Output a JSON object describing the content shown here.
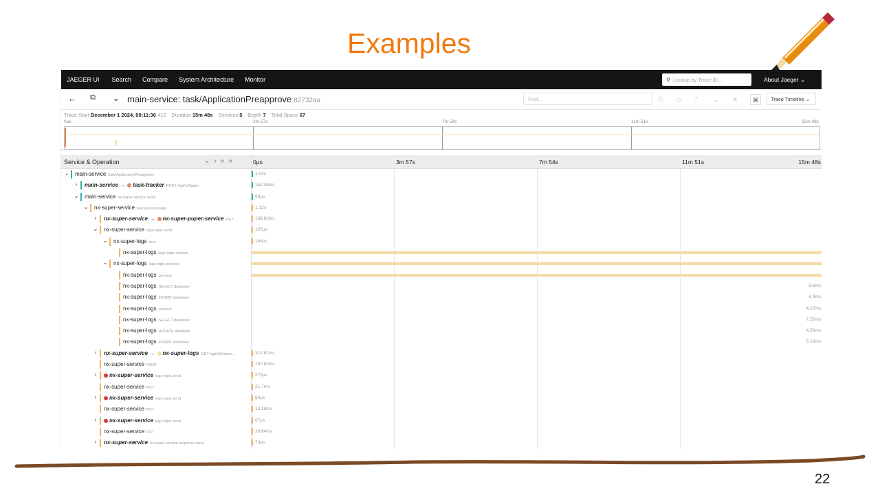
{
  "slide": {
    "title": "Examples",
    "page_number": "22"
  },
  "nav": {
    "brand": "JAEGER UI",
    "items": [
      "Search",
      "Compare",
      "System Architecture",
      "Monitor"
    ],
    "lookup_placeholder": "Lookup by Trace ID...",
    "about": "About Jaeger"
  },
  "trace": {
    "service": "main-service",
    "name": "main-service: task/ApplicationPreapprove",
    "id": "82732aa",
    "find_placeholder": "Find...",
    "timeline_button": "Trace Timeline"
  },
  "meta": {
    "start_label": "Trace Start",
    "start_value": "December 1 2024, 00:11:36",
    "start_ms": ".412",
    "duration_label": "Duration",
    "duration_value": "15m 48s",
    "services_label": "Services",
    "services_value": "5",
    "depth_label": "Depth",
    "depth_value": "7",
    "spans_label": "Total Spans",
    "spans_value": "67"
  },
  "ticks": [
    "0μs",
    "3m 57s",
    "7m 54s",
    "11m 51s",
    "15m 48s"
  ],
  "header": {
    "service_operation": "Service & Operation"
  },
  "colors": {
    "main": "#2bb5a8",
    "super": "#f2b25e",
    "tracker": "#e08a5c",
    "error": "#d9363e",
    "bar": "#f3dca7"
  },
  "rows": [
    {
      "depth": 0,
      "toggle": "v",
      "svc": "main-service",
      "op": "task/ApplicationPreapprove",
      "bold": false,
      "color": "main",
      "dur": "1.04s"
    },
    {
      "depth": 1,
      "toggle": ">",
      "svc": "main-service",
      "bold": true,
      "arrow": true,
      "dot": "tracker",
      "svc2": "task-tracker",
      "op": "POST /api/v1/tasks",
      "color": "main",
      "dur": "152.36ms"
    },
    {
      "depth": 1,
      "toggle": "v",
      "svc": "main-service",
      "op": "nx-super-service send",
      "bold": false,
      "color": "main",
      "dur": "69μs"
    },
    {
      "depth": 2,
      "toggle": "v",
      "svc": "nx-super-service",
      "op": "process message",
      "bold": false,
      "color": "super",
      "dur": "1.12s"
    },
    {
      "depth": 3,
      "toggle": ">",
      "svc": "nx-super-service",
      "bold": true,
      "arrow": true,
      "dot": "tracker",
      "svc2": "nx-super-puper-service",
      "op": "GET ...",
      "color": "super",
      "dur": "138.82ms"
    },
    {
      "depth": 3,
      "toggle": "v",
      "svc": "nx-super-service",
      "op": "logs-topic send",
      "bold": false,
      "color": "super",
      "dur": "107μs"
    },
    {
      "depth": 4,
      "toggle": "v",
      "svc": "nx-super-logs",
      "op": "recv",
      "bold": false,
      "color": "super",
      "dur": "146μs"
    },
    {
      "depth": 5,
      "toggle": "",
      "svc": "nx-super-logs",
      "op": "logs-topic receive",
      "bold": false,
      "color": "super",
      "bar": true
    },
    {
      "depth": 4,
      "toggle": "v",
      "svc": "nx-super-logs",
      "op": "logs-topic process",
      "bold": false,
      "color": "super",
      "bar": true
    },
    {
      "depth": 5,
      "toggle": "",
      "svc": "nx-super-logs",
      "op": "connect",
      "bold": false,
      "color": "super",
      "bar": true
    },
    {
      "depth": 5,
      "toggle": "",
      "svc": "nx-super-logs",
      "op": "SELECT database",
      "bold": false,
      "color": "super",
      "right": "8.6ms"
    },
    {
      "depth": 5,
      "toggle": "",
      "svc": "nx-super-logs",
      "op": "INSERT database",
      "bold": false,
      "color": "super",
      "right": "4.3ms"
    },
    {
      "depth": 5,
      "toggle": "",
      "svc": "nx-super-logs",
      "op": "connect",
      "bold": false,
      "color": "super",
      "right": "4.17ms"
    },
    {
      "depth": 5,
      "toggle": "",
      "svc": "nx-super-logs",
      "op": "SELECT database",
      "bold": false,
      "color": "super",
      "right": "7.55ms"
    },
    {
      "depth": 5,
      "toggle": "",
      "svc": "nx-super-logs",
      "op": "UPDATE database",
      "bold": false,
      "color": "super",
      "right": "4.56ms"
    },
    {
      "depth": 5,
      "toggle": "",
      "svc": "nx-super-logs",
      "op": "INSERT database",
      "bold": false,
      "color": "super",
      "right": "5.16ms"
    },
    {
      "depth": 3,
      "toggle": ">",
      "svc": "nx-super-service",
      "bold": true,
      "arrow": true,
      "dot": "bar",
      "svc2": "nx-super-logs",
      "op": "GET /api/v1/intern...",
      "color": "super",
      "dur": "312.81ms"
    },
    {
      "depth": 3,
      "toggle": "",
      "svc": "nx-super-service",
      "op": "POST",
      "bold": false,
      "color": "super",
      "dur": "797.82ms"
    },
    {
      "depth": 3,
      "toggle": ">",
      "svc": "nx-super-service",
      "bold": true,
      "errdot": true,
      "op": "logs-topic send",
      "color": "super",
      "dur": "270μs"
    },
    {
      "depth": 3,
      "toggle": "",
      "svc": "nx-super-service",
      "op": "PUT",
      "bold": false,
      "color": "super",
      "dur": "21.7ms"
    },
    {
      "depth": 3,
      "toggle": ">",
      "svc": "nx-super-service",
      "bold": true,
      "errdot": true,
      "op": "logs-topic send",
      "color": "super",
      "dur": "84μs"
    },
    {
      "depth": 3,
      "toggle": "",
      "svc": "nx-super-service",
      "op": "PUT",
      "bold": false,
      "color": "super",
      "dur": "13.16ms"
    },
    {
      "depth": 3,
      "toggle": ">",
      "svc": "nx-super-service",
      "bold": true,
      "errdot": true,
      "op": "logs-topic send",
      "color": "super",
      "dur": "67μs"
    },
    {
      "depth": 3,
      "toggle": "",
      "svc": "nx-super-service",
      "op": "PUT",
      "bold": false,
      "color": "super",
      "dur": "29.84ms"
    },
    {
      "depth": 3,
      "toggle": ">",
      "svc": "nx-super-service",
      "op": "nx-super-service.response send",
      "bold": true,
      "color": "super",
      "dur": "73μs"
    }
  ]
}
